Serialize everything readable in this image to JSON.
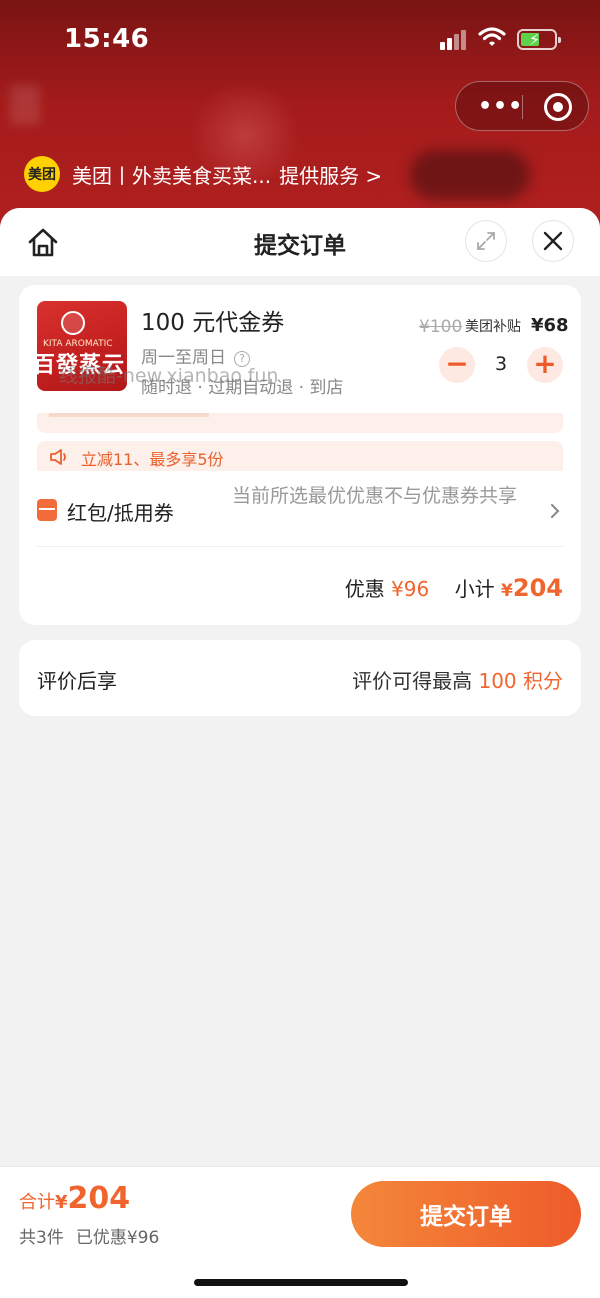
{
  "status_bar": {
    "time": "15:46"
  },
  "mini_program": {
    "logo_text": "美团",
    "service_name": "美团丨外卖美食买菜...",
    "provide_label": "提供服务 >"
  },
  "header": {
    "title": "提交订单"
  },
  "product": {
    "title": "100 元代金券",
    "days": "周一至周日",
    "tags": "随时退 · 过期自动退 · 到店",
    "original_price": "¥100",
    "subsidy_label": "美团补贴",
    "final_price": "¥68",
    "quantity": "3",
    "minus": "−",
    "plus": "+",
    "watermark": "线报酷-new.xianbao.fun",
    "thumb_small_text": "KITA AROMATIC",
    "thumb_big_text": "百發蒸云"
  },
  "promo": {
    "text": "立减11、最多享5份"
  },
  "coupon": {
    "label": "红包/抵用券",
    "note": "当前所选最优优惠不与优惠券共享"
  },
  "subtotal": {
    "discount_label": "优惠",
    "discount_value": "¥96",
    "subtotal_label": "小计",
    "subtotal_symbol": "¥",
    "subtotal_value": "204"
  },
  "points": {
    "left_label": "评价后享",
    "right_prefix": "评价可得最高",
    "right_value": "100 积分"
  },
  "bottom": {
    "total_label": "合计",
    "total_symbol": "¥",
    "total_value": "204",
    "count_text": "共3件",
    "discount_text": "已优惠¥96",
    "submit_label": "提交订单"
  },
  "colors": {
    "accent": "#f0652e",
    "header_red": "#a41b1b",
    "button_gradient_start": "#f4873a",
    "button_gradient_end": "#ee5b2a"
  }
}
